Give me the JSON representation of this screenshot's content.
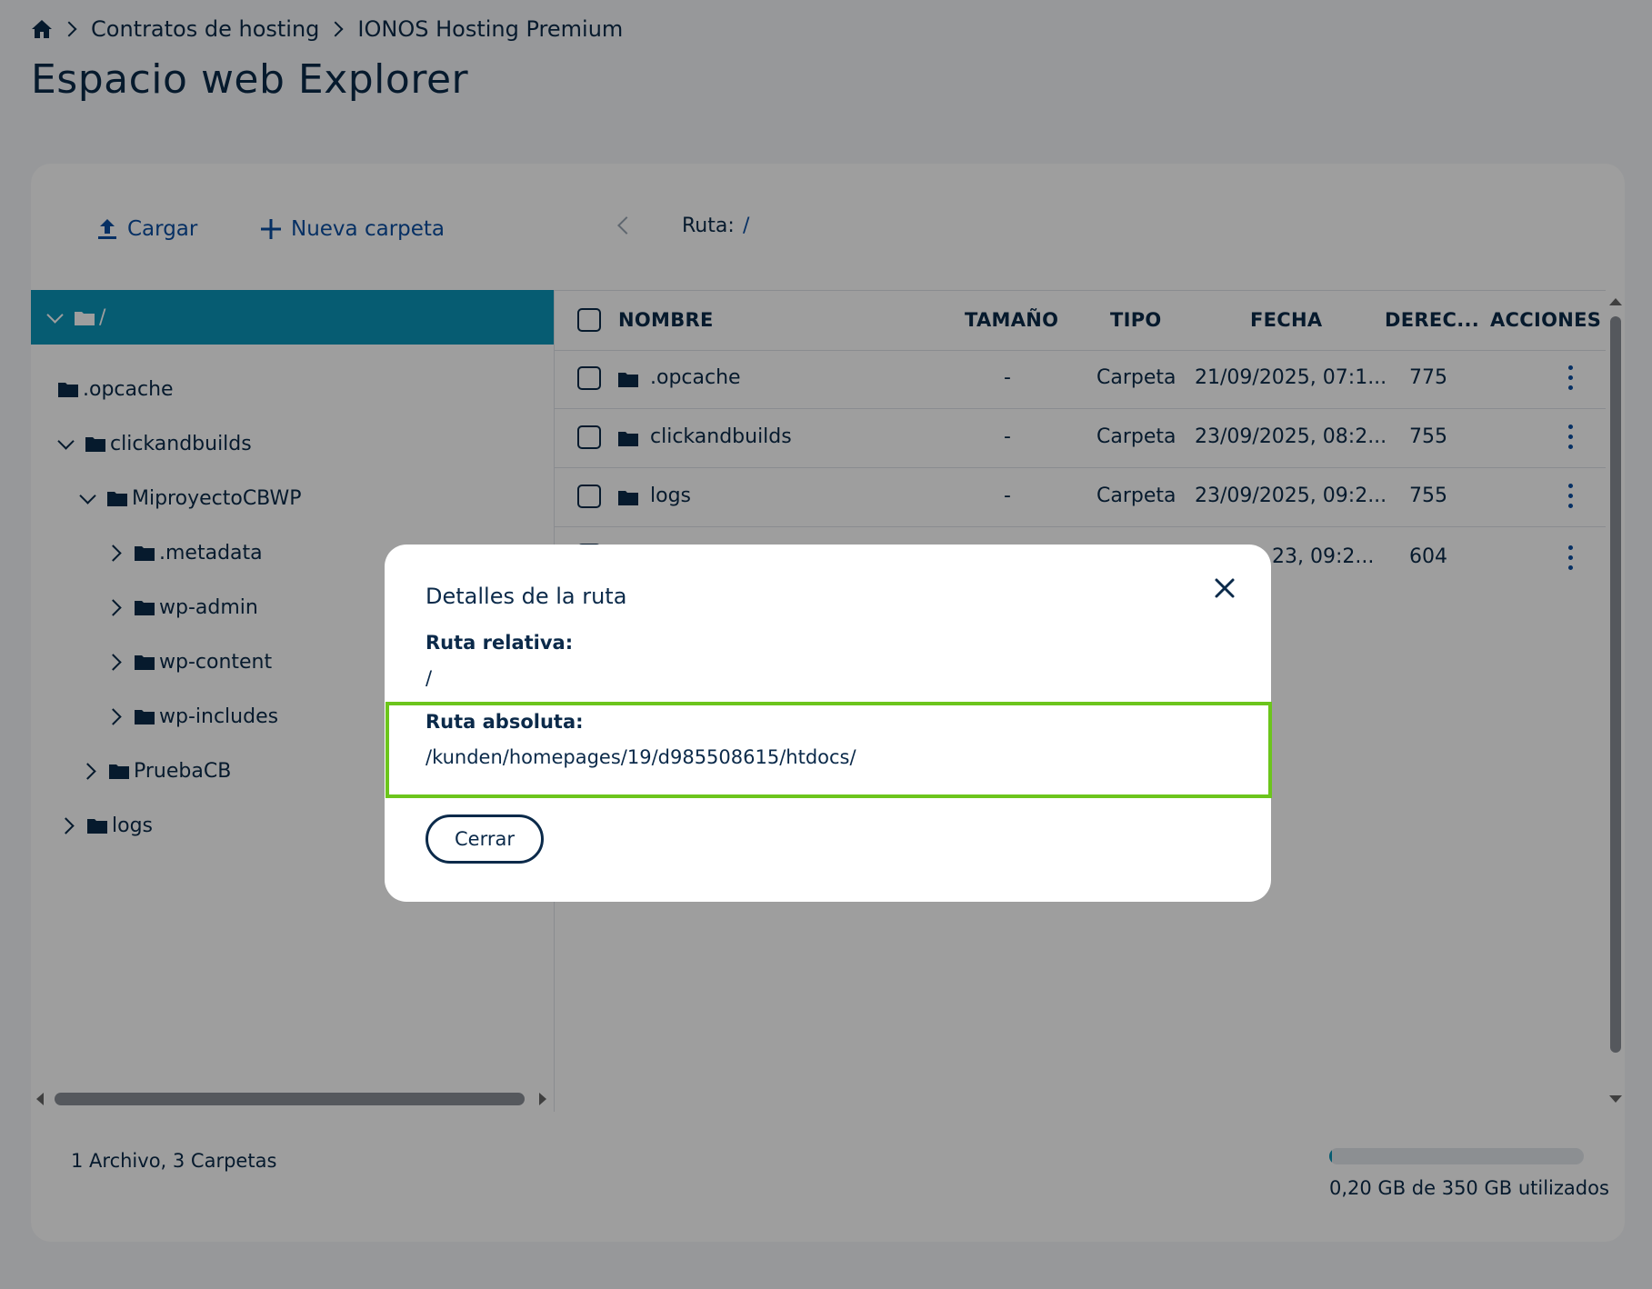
{
  "breadcrumb": {
    "items": [
      "Contratos de hosting",
      "IONOS Hosting Premium"
    ]
  },
  "page_title": "Espacio web Explorer",
  "toolbar": {
    "upload_label": "Cargar",
    "new_folder_label": "Nueva carpeta",
    "path_label": "Ruta:",
    "path_value": "/"
  },
  "tree": {
    "root_label": "/",
    "items": [
      {
        "label": ".opcache"
      },
      {
        "label": "clickandbuilds"
      },
      {
        "label": "MiproyectoCBWP"
      },
      {
        "label": ".metadata"
      },
      {
        "label": "wp-admin"
      },
      {
        "label": "wp-content"
      },
      {
        "label": "wp-includes"
      },
      {
        "label": "PruebaCB"
      },
      {
        "label": "logs"
      }
    ]
  },
  "table": {
    "headers": {
      "name": "NOMBRE",
      "size": "TAMAÑO",
      "type": "TIPO",
      "date": "FECHA",
      "rights": "DEREC...",
      "actions": "ACCIONES"
    },
    "rows": [
      {
        "name": ".opcache",
        "size": "-",
        "type": "Carpeta",
        "date": "21/09/2025, 07:1...",
        "rights": "775"
      },
      {
        "name": "clickandbuilds",
        "size": "-",
        "type": "Carpeta",
        "date": "23/09/2025, 08:2...",
        "rights": "755"
      },
      {
        "name": "logs",
        "size": "-",
        "type": "Carpeta",
        "date": "23/09/2025, 09:2...",
        "rights": "755"
      },
      {
        "name": "",
        "size": "",
        "type": "",
        "date": "23, 09:2...",
        "rights": "604"
      }
    ]
  },
  "footer": {
    "summary": "1 Archivo, 3 Carpetas",
    "storage_text": "0,20 GB de 350 GB utilizados",
    "storage_used_fraction": 0.01
  },
  "modal": {
    "title": "Detalles de la ruta",
    "relative_label": "Ruta relativa:",
    "relative_value": "/",
    "absolute_label": "Ruta absoluta:",
    "absolute_value": "/kunden/homepages/19/d985508615/htdocs/",
    "close_button": "Cerrar"
  },
  "colors": {
    "accent": "#0b95b8",
    "link": "#0b4ea2",
    "text": "#0b2a4a",
    "highlight": "#6cc51c"
  }
}
